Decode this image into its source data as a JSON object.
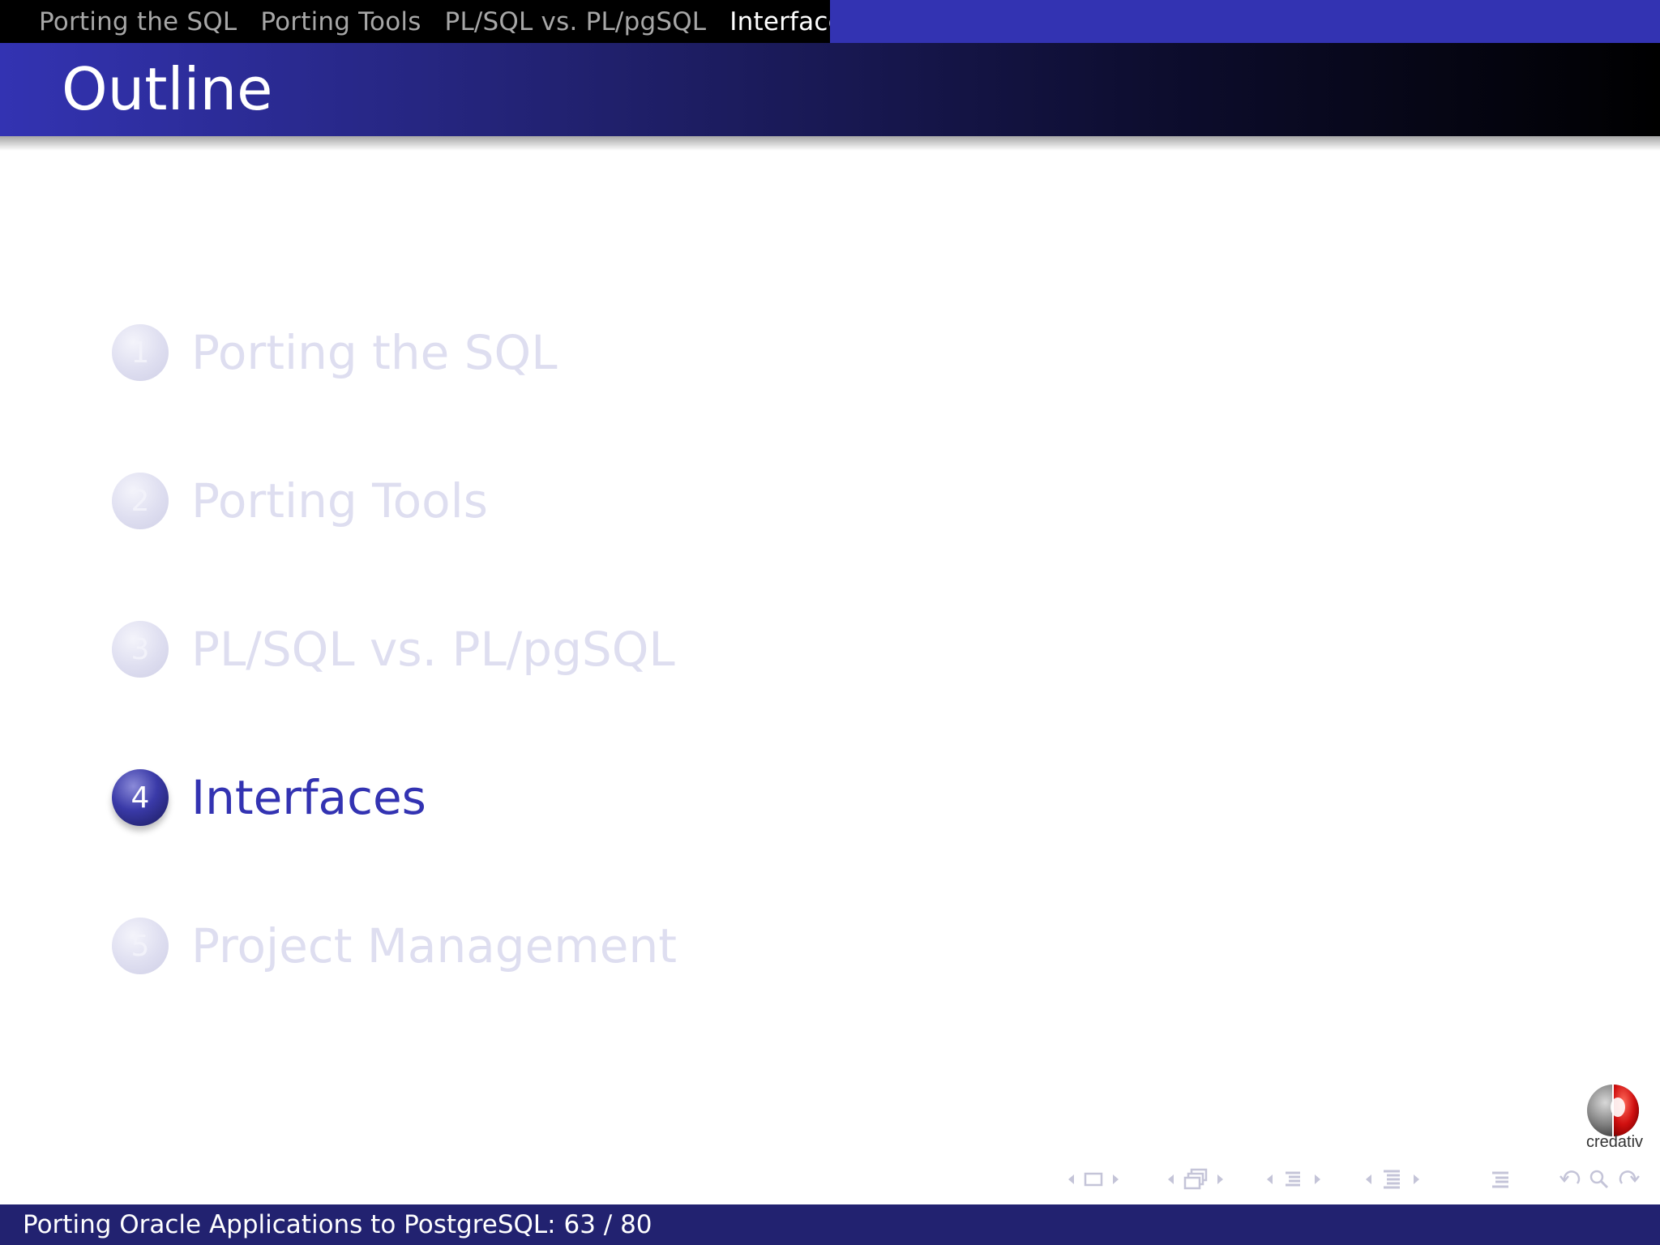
{
  "header": {
    "sections": [
      {
        "label": "Porting the SQL",
        "active": false
      },
      {
        "label": "Porting Tools",
        "active": false
      },
      {
        "label": "PL/SQL vs. PL/pgSQL",
        "active": false
      },
      {
        "label": "Interfaces",
        "active": true
      }
    ]
  },
  "title": "Outline",
  "outline": {
    "items": [
      {
        "number": "1",
        "label": "Porting the SQL",
        "active": false
      },
      {
        "number": "2",
        "label": "Porting Tools",
        "active": false
      },
      {
        "number": "3",
        "label": "PL/SQL vs. PL/pgSQL",
        "active": false
      },
      {
        "number": "4",
        "label": "Interfaces",
        "active": true
      },
      {
        "number": "5",
        "label": "Project Management",
        "active": false
      }
    ]
  },
  "logo": {
    "text": "credativ"
  },
  "footer": {
    "presentation_title": "Porting Oracle Applications to PostgreSQL",
    "page_indicator": "Porting Oracle Applications to PostgreSQL: 63 / 80",
    "current_page": 63,
    "total_pages": 80
  },
  "colors": {
    "theme_blue": "#3333b2",
    "footer_blue": "#222270",
    "dimmed_text": "#dedef0",
    "logo_red": "#d01010"
  },
  "nav_icons": [
    "frame-prev-icon",
    "frame-icon",
    "frame-next-icon",
    "subsection-prev-icon",
    "subsection-icon",
    "subsection-next-icon",
    "section-prev-icon",
    "section-icon",
    "section-next-icon",
    "page-prev-icon",
    "page-icon",
    "page-next-icon",
    "appendix-icon",
    "back-icon",
    "search-icon",
    "forward-icon"
  ]
}
